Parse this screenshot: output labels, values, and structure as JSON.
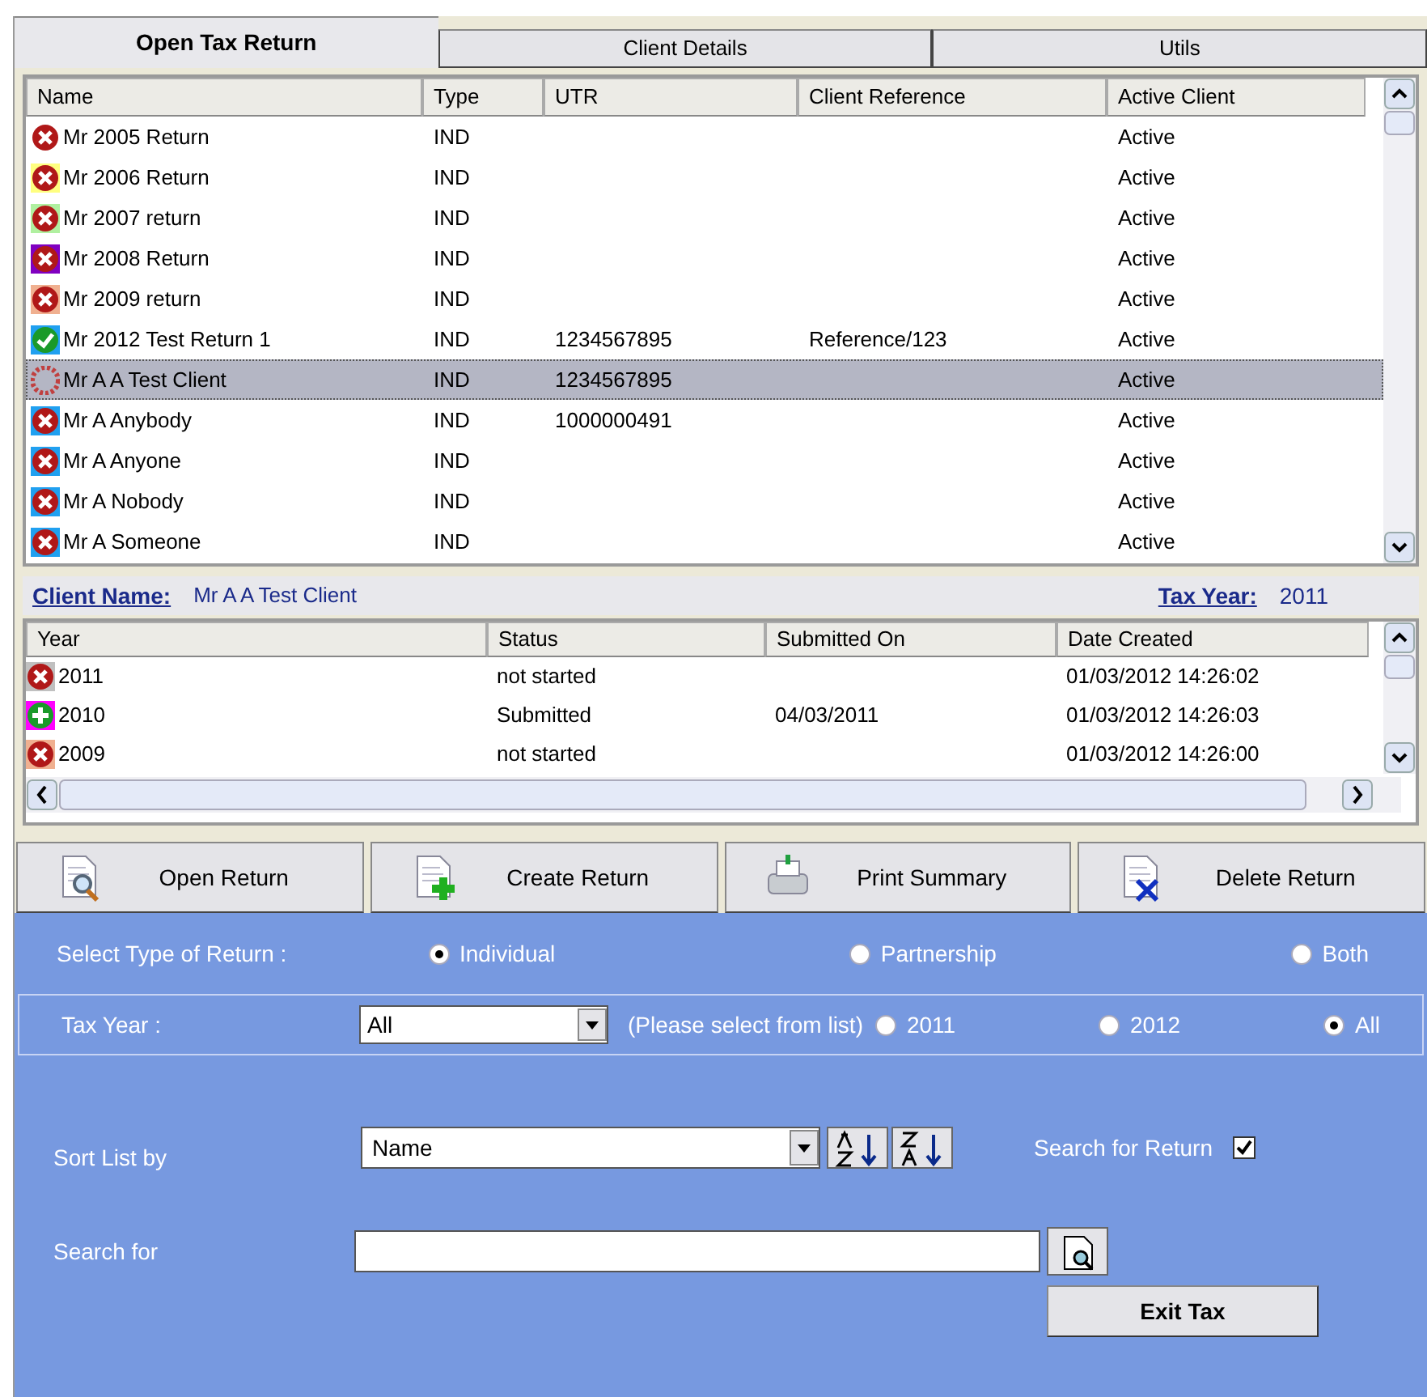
{
  "tabs": [
    {
      "label": "Open Tax Return",
      "selected": true
    },
    {
      "label": "Client Details",
      "selected": false
    },
    {
      "label": "Utils",
      "selected": false
    }
  ],
  "clients": {
    "columns": [
      "Name",
      "Type",
      "UTR",
      "Client Reference",
      "Active Client"
    ],
    "rows": [
      {
        "kind": "cross",
        "selected": false,
        "cells": [
          "Mr 2005 Return",
          "IND",
          "",
          "",
          "Active"
        ]
      },
      {
        "kind": "cross",
        "color": "#ffff80",
        "selected": false,
        "cells": [
          "Mr 2006 Return",
          "IND",
          "",
          "",
          "Active"
        ]
      },
      {
        "kind": "cross",
        "color": "#b0f0a0",
        "selected": false,
        "cells": [
          "Mr 2007 return",
          "IND",
          "",
          "",
          "Active"
        ]
      },
      {
        "kind": "cross",
        "color": "#8000c0",
        "selected": false,
        "cells": [
          "Mr 2008 Return",
          "IND",
          "",
          "",
          "Active"
        ]
      },
      {
        "kind": "cross",
        "color": "#f0b090",
        "selected": false,
        "cells": [
          "Mr 2009 return",
          "IND",
          "",
          "",
          "Active"
        ]
      },
      {
        "kind": "tick",
        "color": "#20a0f0",
        "selected": false,
        "cells": [
          "Mr 2012 Test Return 1",
          "IND",
          "1234567895",
          "Reference/123",
          "Active"
        ]
      },
      {
        "kind": "hatched",
        "selected": true,
        "cells": [
          "Mr A A Test Client",
          "IND",
          "1234567895",
          "",
          "Active"
        ]
      },
      {
        "kind": "cross",
        "color": "#20a0f0",
        "selected": false,
        "cells": [
          "Mr A Anybody",
          "IND",
          "1000000491",
          "",
          "Active"
        ]
      },
      {
        "kind": "cross",
        "color": "#20a0f0",
        "selected": false,
        "cells": [
          "Mr A Anyone",
          "IND",
          "",
          "",
          "Active"
        ]
      },
      {
        "kind": "cross",
        "color": "#20a0f0",
        "selected": false,
        "cells": [
          "Mr A Nobody",
          "IND",
          "",
          "",
          "Active"
        ]
      },
      {
        "kind": "cross",
        "color": "#20a0f0",
        "selected": false,
        "cells": [
          "Mr A Someone",
          "IND",
          "",
          "",
          "Active"
        ]
      }
    ]
  },
  "client_bar": {
    "name_label": "Client Name:",
    "name": "Mr A A Test Client",
    "year_label": "Tax Year:",
    "year": "2011"
  },
  "years": {
    "columns": [
      "Year",
      "Status",
      "Submitted On",
      "Date Created"
    ],
    "rows": [
      {
        "kind": "cross",
        "color": "#c0c0c0",
        "cells": [
          "2011",
          "not started",
          "",
          "01/03/2012 14:26:02"
        ]
      },
      {
        "kind": "plus",
        "color": "#ff00ff",
        "cells": [
          "2010",
          "Submitted",
          "04/03/2011",
          "01/03/2012 14:26:03"
        ]
      },
      {
        "kind": "cross",
        "color": "#f0b090",
        "cells": [
          "2009",
          "not started",
          "",
          "01/03/2012 14:26:00"
        ]
      }
    ]
  },
  "buttons": [
    {
      "kind": "open",
      "label": "Open Return"
    },
    {
      "kind": "create",
      "label": "Create Return"
    },
    {
      "kind": "print",
      "label": "Print Summary"
    },
    {
      "kind": "delete",
      "label": "Delete Return"
    }
  ],
  "return_type": {
    "label": "Select Type of Return :",
    "options": [
      {
        "label": "Individual",
        "selected": true
      },
      {
        "label": "Partnership",
        "selected": false
      },
      {
        "label": "Both",
        "selected": false
      }
    ]
  },
  "tax_year": {
    "label": "Tax Year :",
    "value": "All",
    "hint": "(Please select from list)",
    "options": [
      {
        "label": "2011",
        "selected": false
      },
      {
        "label": "2012",
        "selected": false
      },
      {
        "label": "All",
        "selected": true
      }
    ]
  },
  "sort": {
    "label": "Sort List by",
    "value": "Name"
  },
  "search_return": {
    "label": "Search for Return",
    "checked": true
  },
  "search": {
    "label": "Search for"
  },
  "exit_button": "Exit Tax"
}
